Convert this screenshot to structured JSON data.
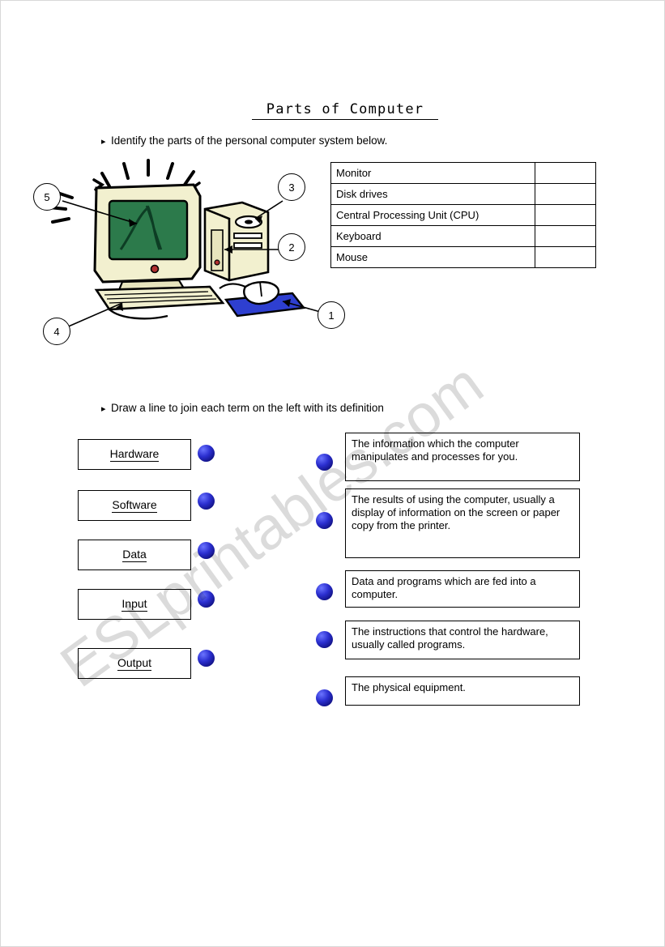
{
  "document": {
    "title": "Parts of Computer",
    "watermark": "ESLprintables.com"
  },
  "exercise1": {
    "instruction": "Identify the parts of the personal computer system below.",
    "bullet": "▸",
    "table": {
      "rows": [
        {
          "label": "Monitor",
          "answer": ""
        },
        {
          "label": "Disk drives",
          "answer": ""
        },
        {
          "label": "Central Processing Unit (CPU)",
          "answer": ""
        },
        {
          "label": "Keyboard",
          "answer": ""
        },
        {
          "label": "Mouse",
          "answer": ""
        }
      ]
    },
    "callouts": [
      {
        "number": "5"
      },
      {
        "number": "3"
      },
      {
        "number": "2"
      },
      {
        "number": "1"
      },
      {
        "number": "4"
      }
    ]
  },
  "exercise2": {
    "instruction": "Draw a line to join each term on the left with its definition",
    "bullet": "▸",
    "terms": [
      {
        "label": "Hardware"
      },
      {
        "label": "Software"
      },
      {
        "label": "Data"
      },
      {
        "label": "Input"
      },
      {
        "label": "Output"
      }
    ],
    "definitions": [
      {
        "text": "The information which the computer manipulates and processes for you."
      },
      {
        "text": "The results of using the computer, usually a display of information on the screen or paper copy from the printer."
      },
      {
        "text": "Data and programs which are fed into a computer."
      },
      {
        "text": "The instructions that control the hardware, usually called programs."
      },
      {
        "text": "The physical equipment."
      }
    ]
  },
  "colors": {
    "dot": "#2b2fd0",
    "monitor_screen": "#2c7a4b",
    "case_body": "#f2f0cf",
    "mouse_pad": "#2e3fd0"
  }
}
